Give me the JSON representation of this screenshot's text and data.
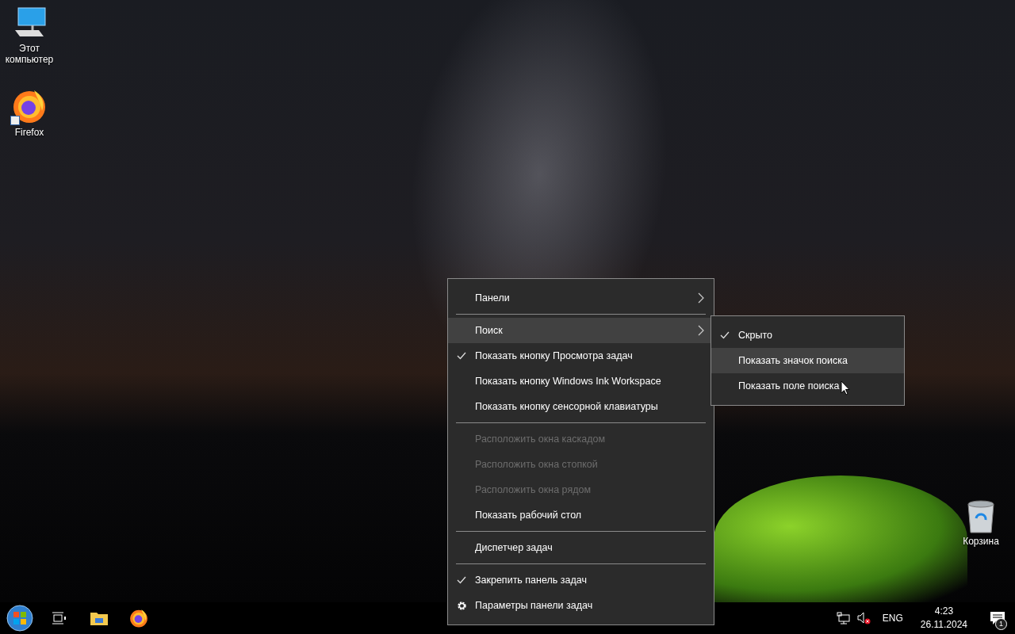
{
  "desktop_icons": [
    {
      "kind": "computer",
      "label": "Этот компьютер"
    },
    {
      "kind": "firefox",
      "label": "Firefox"
    }
  ],
  "recycle_bin": {
    "label": "Корзина"
  },
  "context_menu": {
    "items": [
      {
        "kind": "submenu",
        "label": "Панели",
        "selected": false,
        "checked": false,
        "disabled": false
      },
      {
        "kind": "separator"
      },
      {
        "kind": "submenu",
        "label": "Поиск",
        "selected": true,
        "checked": false,
        "disabled": false
      },
      {
        "kind": "option",
        "label": "Показать кнопку Просмотра задач",
        "selected": false,
        "checked": true,
        "disabled": false
      },
      {
        "kind": "option",
        "label": "Показать кнопку Windows Ink Workspace",
        "selected": false,
        "checked": false,
        "disabled": false
      },
      {
        "kind": "option",
        "label": "Показать кнопку сенсорной клавиатуры",
        "selected": false,
        "checked": false,
        "disabled": false
      },
      {
        "kind": "separator"
      },
      {
        "kind": "option",
        "label": "Расположить окна каскадом",
        "selected": false,
        "checked": false,
        "disabled": true
      },
      {
        "kind": "option",
        "label": "Расположить окна стопкой",
        "selected": false,
        "checked": false,
        "disabled": true
      },
      {
        "kind": "option",
        "label": "Расположить окна рядом",
        "selected": false,
        "checked": false,
        "disabled": true
      },
      {
        "kind": "option",
        "label": "Показать рабочий стол",
        "selected": false,
        "checked": false,
        "disabled": false
      },
      {
        "kind": "separator"
      },
      {
        "kind": "option",
        "label": "Диспетчер задач",
        "selected": false,
        "checked": false,
        "disabled": false
      },
      {
        "kind": "separator"
      },
      {
        "kind": "option",
        "label": "Закрепить панель задач",
        "selected": false,
        "checked": true,
        "disabled": false
      },
      {
        "kind": "settings",
        "label": "Параметры панели задач",
        "selected": false,
        "disabled": false
      }
    ]
  },
  "submenu": {
    "items": [
      {
        "label": "Скрыто",
        "checked": true,
        "selected": false
      },
      {
        "label": "Показать значок поиска",
        "checked": false,
        "selected": true
      },
      {
        "label": "Показать поле поиска",
        "checked": false,
        "selected": false
      }
    ]
  },
  "taskbar": {
    "pinned": [
      {
        "kind": "start"
      },
      {
        "kind": "task-view"
      },
      {
        "kind": "explorer"
      },
      {
        "kind": "firefox"
      }
    ],
    "language": "ENG",
    "time": "4:23",
    "date": "26.11.2024",
    "notification_count": "1"
  }
}
